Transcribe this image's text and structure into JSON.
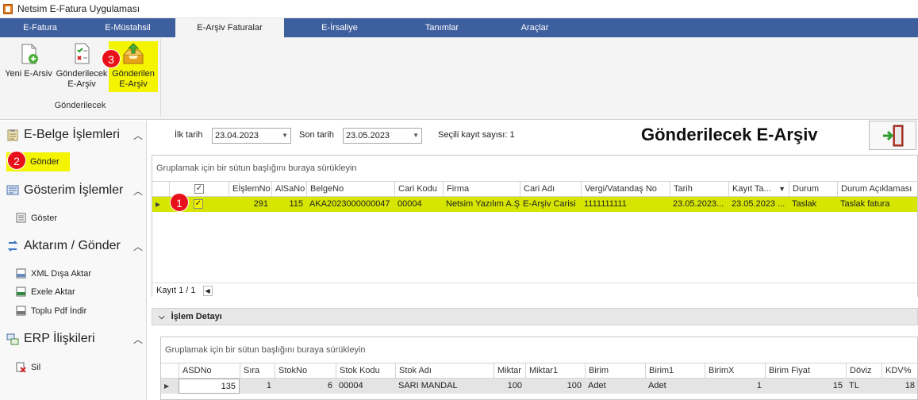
{
  "app": {
    "title": "Netsim E-Fatura Uygulaması"
  },
  "menu": {
    "tabs": [
      "E-Fatura",
      "E-Müstahsil",
      "E-Arşiv Faturalar",
      "E-İrsaliye",
      "Tanımlar",
      "Araçlar"
    ],
    "active": "E-Arşiv Faturalar"
  },
  "ribbon": {
    "buttons": [
      {
        "label1": "Yeni E-Arsiv",
        "label2": ""
      },
      {
        "label1": "Gönderilecek",
        "label2": "E-Arşiv"
      },
      {
        "label1": "Gönderilen",
        "label2": "E-Arşiv"
      }
    ],
    "group_label": "Gönderilecek",
    "highlight_color": "#f5f400"
  },
  "badges": [
    "1",
    "2",
    "3"
  ],
  "sidebar": {
    "sections": [
      {
        "title": "E-Belge İşlemleri",
        "items": [
          "Gönder"
        ]
      },
      {
        "title": "Gösterim İşlemler",
        "items": [
          "Göster"
        ]
      },
      {
        "title": "Aktarım / Gönder",
        "items": [
          "XML Dışa Aktar",
          "Exele Aktar",
          "Toplu Pdf İndir"
        ]
      },
      {
        "title": "ERP İlişkileri",
        "items": [
          "Sil"
        ]
      }
    ]
  },
  "filters": {
    "start_label": "İlk tarih",
    "start_value": "23.04.2023",
    "end_label": "Son tarih",
    "end_value": "23.05.2023",
    "selected_count": "Seçili kayıt sayısı: 1"
  },
  "page_title": "Gönderilecek E-Arşiv",
  "grid": {
    "group_hint": "Gruplamak için bir sütun başlığını buraya sürükleyin",
    "columns": [
      "EİşlemNo",
      "AlSaNo",
      "BelgeNo",
      "Cari Kodu",
      "Firma",
      "Cari Adı",
      "Vergi/Vatandaş No",
      "Tarih",
      "Kayıt Ta...",
      "Durum",
      "Durum Açıklaması"
    ],
    "rows": [
      [
        "291",
        "115",
        "AKA2023000000047",
        "00004",
        "Netsim Yazılım A.Ş",
        "E-Arşiv Carisi",
        "1111111111",
        "23.05.2023...",
        "23.05.2023 ...",
        "Taslak",
        "Taslak fatura"
      ]
    ],
    "row_highlight": "#d7e600",
    "footer": "Kayıt 1 / 1"
  },
  "detail": {
    "title": "İşlem Detayı",
    "group_hint": "Gruplamak için bir sütun başlığını buraya sürükleyin",
    "columns": [
      "ASDNo",
      "Sıra",
      "StokNo",
      "Stok Kodu",
      "Stok Adı",
      "Miktar",
      "Miktar1",
      "Birim",
      "Birim1",
      "BirimX",
      "Birim Fiyat",
      "Döviz",
      "KDV%"
    ],
    "rows": [
      [
        "135",
        "1",
        "6",
        "00004",
        "SARI MANDAL",
        "100",
        "100",
        "Adet",
        "Adet",
        "1",
        "15",
        "TL",
        "18"
      ]
    ]
  }
}
